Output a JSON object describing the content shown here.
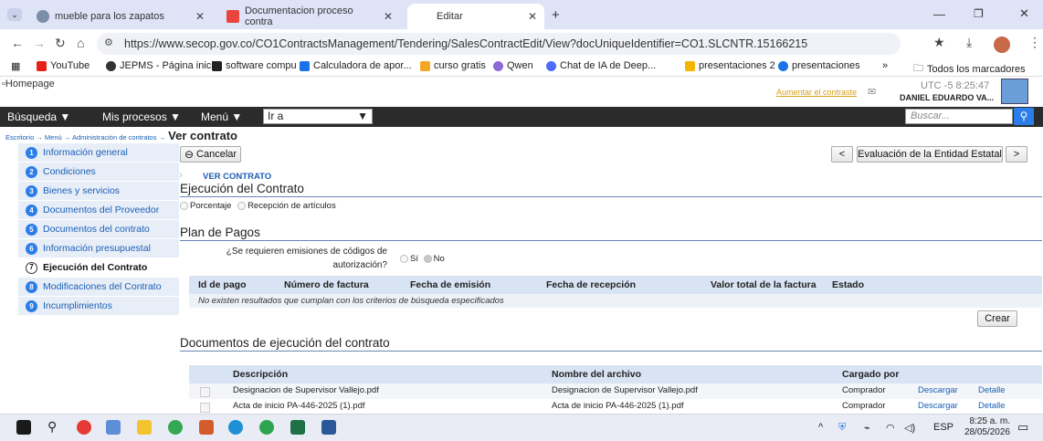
{
  "browser": {
    "tabs": [
      {
        "title": "mueble para los zapatos",
        "active": false
      },
      {
        "title": "Documentacion proceso contra",
        "active": false
      },
      {
        "title": "Editar",
        "active": true
      }
    ],
    "url": "https://www.secop.gov.co/CO1ContractsManagement/Tendering/SalesContractEdit/View?docUniqueIdentifier=CO1.SLCNTR.15166215",
    "bookmarks": [
      "YouTube",
      "JEPMS - Página inici...",
      "software compu",
      "Calculadora de apor...",
      "curso gratis",
      "Qwen",
      "Chat de IA de Deep...",
      "presentaciones 2",
      "presentaciones"
    ],
    "all_bookmarks": "Todos los marcadores",
    "more": "»"
  },
  "header": {
    "logo_alt": "Homepage",
    "contrast_link": "Aumentar el contraste",
    "clock": "UTC -5 8:25:47",
    "user": "DANIEL EDUARDO VA..."
  },
  "navbar": {
    "busqueda": "Búsqueda ▼",
    "procesos": "Mis procesos ▼",
    "menu": "Menú ▼",
    "ira": "Ir a",
    "buscar_placeholder": "Buscar..."
  },
  "breadcrumb": {
    "path": "Escritorio → Menú → Administración de contratos →",
    "current": "Ver contrato"
  },
  "sidebar": {
    "items": [
      {
        "num": "1",
        "label": "Información general"
      },
      {
        "num": "2",
        "label": "Condiciones"
      },
      {
        "num": "3",
        "label": "Bienes y servicios"
      },
      {
        "num": "4",
        "label": "Documentos del Proveedor"
      },
      {
        "num": "5",
        "label": "Documentos del contrato"
      },
      {
        "num": "6",
        "label": "Información presupuestal"
      },
      {
        "num": "7",
        "label": "Ejecución del Contrato"
      },
      {
        "num": "8",
        "label": "Modificaciones del Contrato"
      },
      {
        "num": "9",
        "label": "Incumplimientos"
      }
    ],
    "active_index": 6
  },
  "toolbar": {
    "cancel": "Cancelar",
    "prev": "<",
    "eval": "Evaluación de la Entidad Estatal",
    "next": ">"
  },
  "main": {
    "ver_contrato": "VER CONTRATO",
    "ejecucion_title": "Ejecución del Contrato",
    "radio_porcentaje": "Porcentaje",
    "radio_recepcion": "Recepción de artículos",
    "plan_title": "Plan de Pagos",
    "question_line1": "¿Se requieren emisiones de códigos de",
    "question_line2": "autorización?",
    "si": "Sí",
    "no": "No",
    "pay_headers": [
      "Id de pago",
      "Número de factura",
      "Fecha de emisión",
      "Fecha de recepción",
      "Valor total de la factura",
      "Estado"
    ],
    "no_results": "No existen resultados que cumplan con los criterios de búsqueda especificados",
    "crear": "Crear",
    "docs_title": "Documentos de ejecución del contrato",
    "doc_headers": [
      "Descripción",
      "Nombre del archivo",
      "Cargado por"
    ],
    "docs": [
      {
        "desc": "Designacion de Supervisor Vallejo.pdf",
        "file": "Designacion de Supervisor Vallejo.pdf",
        "by": "Comprador",
        "download": "Descargar",
        "detail": "Detalle"
      },
      {
        "desc": "Acta de inicio PA-446-2025 (1).pdf",
        "file": "Acta de inicio PA-446-2025 (1).pdf",
        "by": "Comprador",
        "download": "Descargar",
        "detail": "Detalle"
      }
    ]
  },
  "taskbar": {
    "lang": "ESP",
    "time": "8:25 a. m.",
    "date": "28/05/2026"
  }
}
